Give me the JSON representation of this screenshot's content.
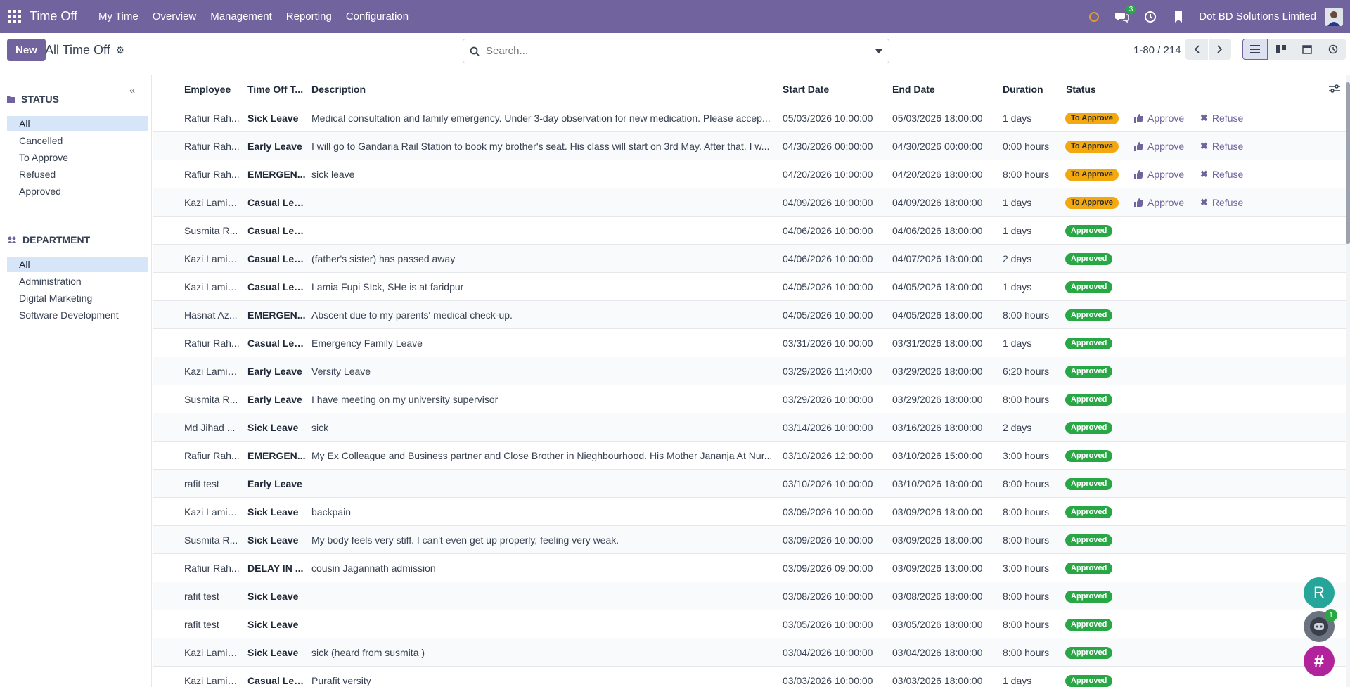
{
  "nav": {
    "app_title": "Time Off",
    "menu": [
      "My Time",
      "Overview",
      "Management",
      "Reporting",
      "Configuration"
    ],
    "chat_badge": "3",
    "company": "Dot BD Solutions Limited"
  },
  "control": {
    "new_label": "New",
    "breadcrumb": "All Time Off",
    "search_placeholder": "Search...",
    "pager": "1-80 / 214"
  },
  "sidebar": {
    "status_title": "STATUS",
    "status_items": [
      "All",
      "Cancelled",
      "To Approve",
      "Refused",
      "Approved"
    ],
    "department_title": "DEPARTMENT",
    "department_items": [
      "All",
      "Administration",
      "Digital Marketing",
      "Software Development"
    ]
  },
  "table": {
    "headers": [
      "Employee",
      "Time Off T...",
      "Description",
      "Start Date",
      "End Date",
      "Duration",
      "Status"
    ],
    "approve_label": "Approve",
    "refuse_label": "Refuse",
    "rows": [
      {
        "employee": "Rafiur Rah...",
        "type": "Sick Leave",
        "description": "Medical consultation and family emergency. Under 3-day observation for new medication. Please accep...",
        "start": "05/03/2026 10:00:00",
        "end": "05/03/2026 18:00:00",
        "duration": "1 days",
        "status": "To Approve"
      },
      {
        "employee": "Rafiur Rah...",
        "type": "Early Leave",
        "description": "I will go to Gandaria Rail Station to book my brother's seat. His class will start on 3rd May. After that, I w...",
        "start": "04/30/2026 00:00:00",
        "end": "04/30/2026 00:00:00",
        "duration": "0:00 hours",
        "status": "To Approve"
      },
      {
        "employee": "Rafiur Rah...",
        "type": "EMERGEN...",
        "description": "sick leave",
        "start": "04/20/2026 10:00:00",
        "end": "04/20/2026 18:00:00",
        "duration": "8:00 hours",
        "status": "To Approve"
      },
      {
        "employee": "Kazi Lamia...",
        "type": "Casual Lea...",
        "description": "",
        "start": "04/09/2026 10:00:00",
        "end": "04/09/2026 18:00:00",
        "duration": "1 days",
        "status": "To Approve"
      },
      {
        "employee": "Susmita R...",
        "type": "Casual Lea...",
        "description": "",
        "start": "04/06/2026 10:00:00",
        "end": "04/06/2026 18:00:00",
        "duration": "1 days",
        "status": "Approved"
      },
      {
        "employee": "Kazi Lamia...",
        "type": "Casual Lea...",
        "description": "(father's sister) has passed away",
        "start": "04/06/2026 10:00:00",
        "end": "04/07/2026 18:00:00",
        "duration": "2 days",
        "status": "Approved"
      },
      {
        "employee": "Kazi Lamia...",
        "type": "Casual Lea...",
        "description": "Lamia Fupi SIck, SHe is at faridpur",
        "start": "04/05/2026 10:00:00",
        "end": "04/05/2026 18:00:00",
        "duration": "1 days",
        "status": "Approved"
      },
      {
        "employee": "Hasnat Az...",
        "type": "EMERGEN...",
        "description": "Abscent due to my parents' medical check-up.",
        "start": "04/05/2026 10:00:00",
        "end": "04/05/2026 18:00:00",
        "duration": "8:00 hours",
        "status": "Approved"
      },
      {
        "employee": "Rafiur Rah...",
        "type": "Casual Lea...",
        "description": "Emergency Family Leave",
        "start": "03/31/2026 10:00:00",
        "end": "03/31/2026 18:00:00",
        "duration": "1 days",
        "status": "Approved"
      },
      {
        "employee": "Kazi Lamia...",
        "type": "Early Leave",
        "description": "Versity Leave",
        "start": "03/29/2026 11:40:00",
        "end": "03/29/2026 18:00:00",
        "duration": "6:20 hours",
        "status": "Approved"
      },
      {
        "employee": "Susmita R...",
        "type": "Early Leave",
        "description": "I have meeting on my university supervisor",
        "start": "03/29/2026 10:00:00",
        "end": "03/29/2026 18:00:00",
        "duration": "8:00 hours",
        "status": "Approved"
      },
      {
        "employee": "Md Jihad ...",
        "type": "Sick Leave",
        "description": "sick",
        "start": "03/14/2026 10:00:00",
        "end": "03/16/2026 18:00:00",
        "duration": "2 days",
        "status": "Approved"
      },
      {
        "employee": "Rafiur Rah...",
        "type": "EMERGEN...",
        "description": "My Ex Colleague and Business partner and Close Brother in Nieghbourhood. His Mother Jananja At Nur...",
        "start": "03/10/2026 12:00:00",
        "end": "03/10/2026 15:00:00",
        "duration": "3:00 hours",
        "status": "Approved"
      },
      {
        "employee": "rafit test",
        "type": "Early Leave",
        "description": "",
        "start": "03/10/2026 10:00:00",
        "end": "03/10/2026 18:00:00",
        "duration": "8:00 hours",
        "status": "Approved"
      },
      {
        "employee": "Kazi Lamia...",
        "type": "Sick Leave",
        "description": "backpain",
        "start": "03/09/2026 10:00:00",
        "end": "03/09/2026 18:00:00",
        "duration": "8:00 hours",
        "status": "Approved"
      },
      {
        "employee": "Susmita R...",
        "type": "Sick Leave",
        "description": "My body feels very stiff. I can't even get up properly, feeling very weak.",
        "start": "03/09/2026 10:00:00",
        "end": "03/09/2026 18:00:00",
        "duration": "8:00 hours",
        "status": "Approved"
      },
      {
        "employee": "Rafiur Rah...",
        "type": "DELAY IN ...",
        "description": "cousin Jagannath admission",
        "start": "03/09/2026 09:00:00",
        "end": "03/09/2026 13:00:00",
        "duration": "3:00 hours",
        "status": "Approved"
      },
      {
        "employee": "rafit test",
        "type": "Sick Leave",
        "description": "",
        "start": "03/08/2026 10:00:00",
        "end": "03/08/2026 18:00:00",
        "duration": "8:00 hours",
        "status": "Approved"
      },
      {
        "employee": "rafit test",
        "type": "Sick Leave",
        "description": "",
        "start": "03/05/2026 10:00:00",
        "end": "03/05/2026 18:00:00",
        "duration": "8:00 hours",
        "status": "Approved"
      },
      {
        "employee": "Kazi Lamia...",
        "type": "Sick Leave",
        "description": "sick (heard from susmita )",
        "start": "03/04/2026 10:00:00",
        "end": "03/04/2026 18:00:00",
        "duration": "8:00 hours",
        "status": "Approved"
      },
      {
        "employee": "Kazi Lamia...",
        "type": "Casual Lea...",
        "description": "Purafit versity",
        "start": "03/03/2026 10:00:00",
        "end": "03/03/2026 18:00:00",
        "duration": "1 days",
        "status": "Approved"
      }
    ]
  },
  "floating": {
    "avatar_letter": "R",
    "bot_badge": "1",
    "hash_symbol": "#"
  },
  "colors": {
    "brand": "#71639e",
    "approved": "#28a745",
    "to_approve": "#f4a810"
  }
}
